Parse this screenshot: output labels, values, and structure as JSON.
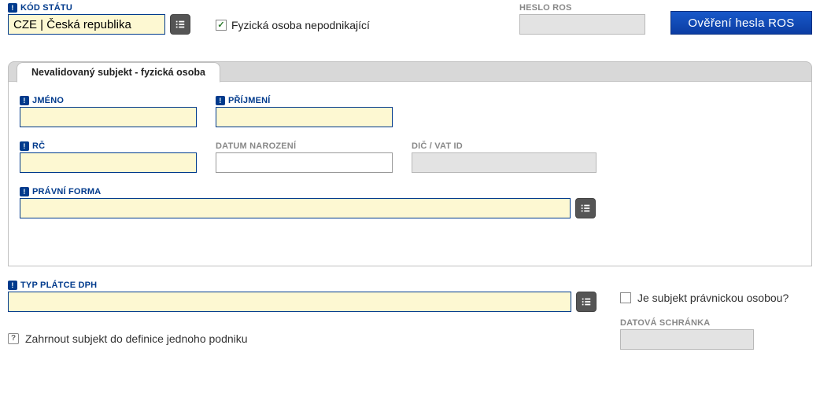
{
  "top": {
    "kod_statu": {
      "label": "KÓD STÁTU",
      "value": "CZE | Česká republika"
    },
    "fyzicka_osoba_label": "Fyzická osoba nepodnikající",
    "heslo_ros": {
      "label": "HESLO ROS",
      "value": ""
    },
    "overeni_btn": "Ověření hesla ROS"
  },
  "tab": {
    "label": "Nevalidovaný subjekt - fyzická osoba"
  },
  "form": {
    "jmeno": {
      "label": "JMÉNO",
      "value": ""
    },
    "prijmeni": {
      "label": "PŘÍJMENÍ",
      "value": ""
    },
    "rc": {
      "label": "RČ",
      "value": ""
    },
    "datum_narozeni": {
      "label": "DATUM NAROZENÍ",
      "value": ""
    },
    "dic": {
      "label": "DIČ / VAT ID",
      "value": ""
    },
    "pravni_forma": {
      "label": "PRÁVNÍ FORMA",
      "value": ""
    }
  },
  "bottom": {
    "typ_platce": {
      "label": "TYP PLÁTCE DPH",
      "value": ""
    },
    "je_pravnicka": "Je subjekt právnickou osobou?",
    "zahrnout": "Zahrnout subjekt do definice jednoho podniku",
    "datova_schranka": {
      "label": "DATOVÁ SCHRÁNKA",
      "value": ""
    }
  }
}
